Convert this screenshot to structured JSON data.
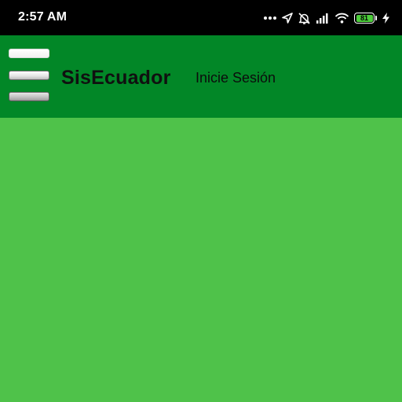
{
  "status_bar": {
    "time": "2:57 AM",
    "battery_level": "81",
    "icons": [
      "more-dots-icon",
      "location-arrow-icon",
      "alarm-off-icon",
      "signal-icon",
      "wifi-icon",
      "battery-icon",
      "charging-bolt-icon"
    ]
  },
  "header": {
    "title": "SisEcuador",
    "login_label": "Inicie Sesión",
    "menu_icon": "menu-icon"
  },
  "colors": {
    "status_bar": "#000000",
    "header": "#028727",
    "background": "#4fc24a",
    "battery_fill": "#4ccd3a"
  }
}
